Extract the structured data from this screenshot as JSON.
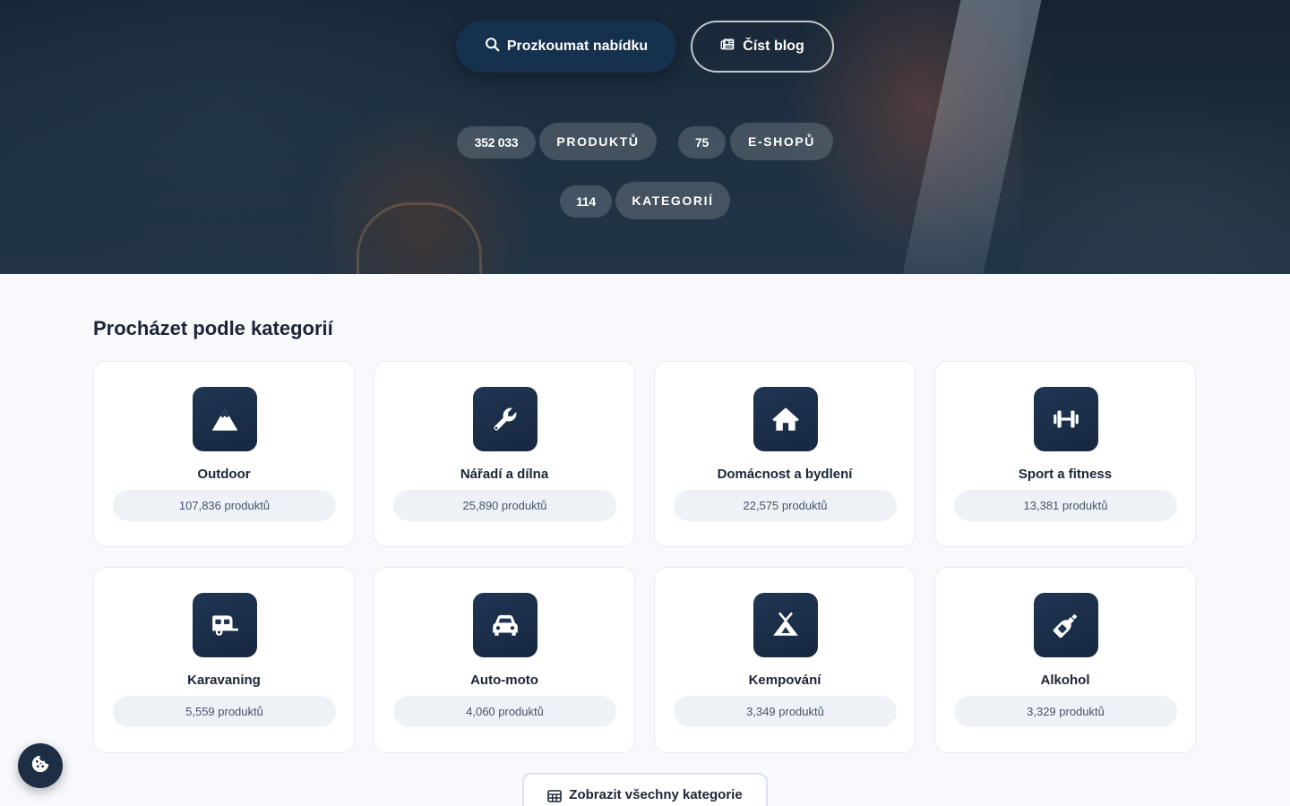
{
  "hero": {
    "explore_label": "Prozkoumat nabídku",
    "blog_label": "Číst blog",
    "stats": [
      {
        "value": "352 033",
        "label": "PRODUKTŮ"
      },
      {
        "value": "75",
        "label": "E-SHOPŮ"
      },
      {
        "value": "114",
        "label": "KATEGORIÍ"
      }
    ]
  },
  "categories": {
    "title": "Procházet podle kategorií",
    "items": [
      {
        "name": "Outdoor",
        "count": "107,836 produktů",
        "icon": "mountain-icon"
      },
      {
        "name": "Nářadí a dílna",
        "count": "25,890 produktů",
        "icon": "wrench-icon"
      },
      {
        "name": "Domácnost a bydlení",
        "count": "22,575 produktů",
        "icon": "house-icon"
      },
      {
        "name": "Sport a fitness",
        "count": "13,381 produktů",
        "icon": "dumbbell-icon"
      },
      {
        "name": "Karavaning",
        "count": "5,559 produktů",
        "icon": "caravan-icon"
      },
      {
        "name": "Auto-moto",
        "count": "4,060 produktů",
        "icon": "car-icon"
      },
      {
        "name": "Kempování",
        "count": "3,349 produktů",
        "icon": "tent-icon"
      },
      {
        "name": "Alkohol",
        "count": "3,329 produktů",
        "icon": "bottle-icon"
      }
    ],
    "show_all_label": "Zobrazit všechny kategorie"
  },
  "colors": {
    "primary": "#16314e",
    "icon_bg": "#1f3552",
    "card_bg": "#ffffff",
    "page_bg": "#f7f9fc"
  }
}
